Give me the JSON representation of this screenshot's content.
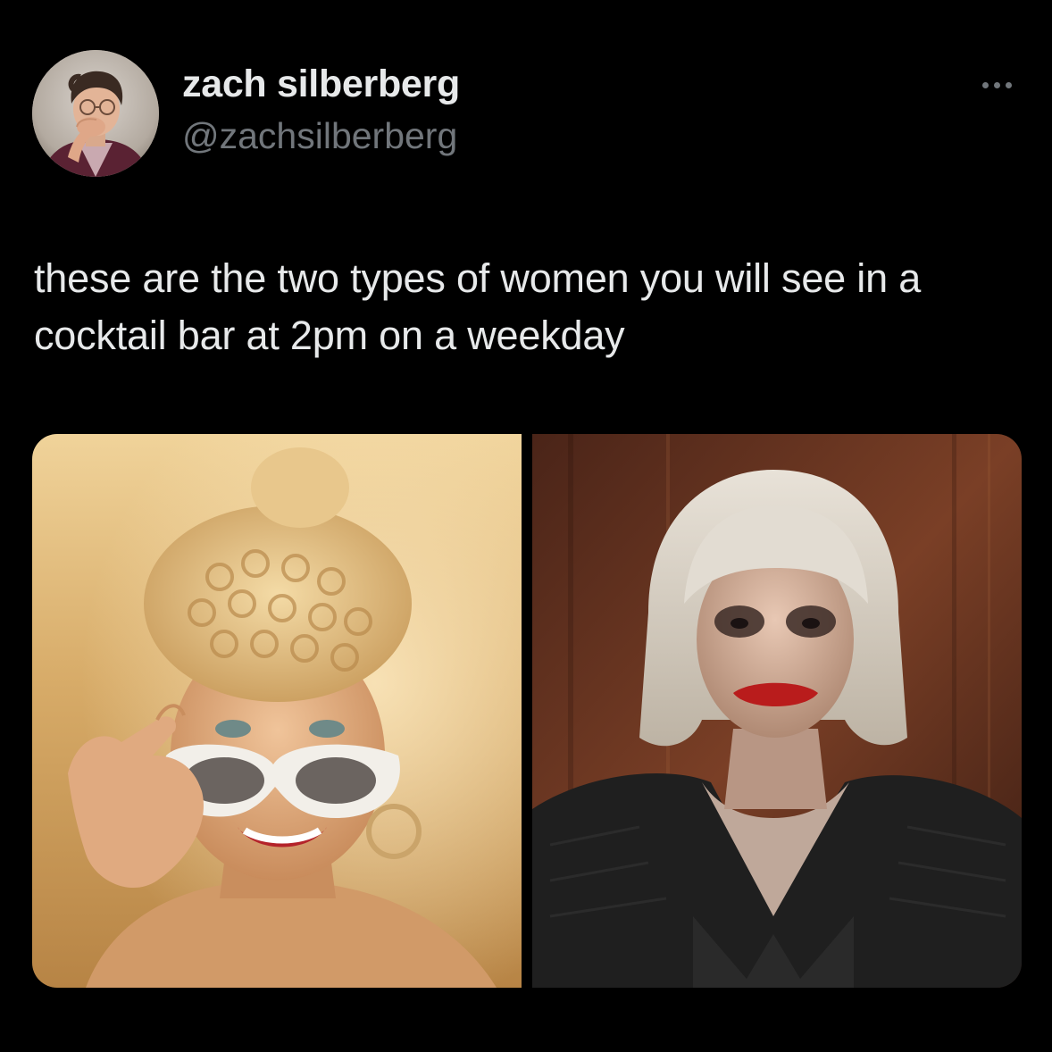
{
  "tweet": {
    "author": {
      "display_name": "zach silberberg",
      "handle": "@zachsilberberg",
      "avatar_icon": "user-avatar-photo"
    },
    "more_icon": "more-horizontal-icon",
    "text": "these are the two types of women you will see in a cocktail bar at 2pm on a weekday",
    "media": [
      {
        "icon": "photo-woman-white-sunglasses",
        "palette": [
          "#e9c98a",
          "#c99a52",
          "#a36f32"
        ]
      },
      {
        "icon": "photo-woman-clown-makeup",
        "palette": [
          "#5a2a1a",
          "#8b4a2b",
          "#1d1d1d"
        ]
      }
    ]
  },
  "colors": {
    "background": "#000000",
    "primary_text": "#e7e9ea",
    "secondary_text": "#71767b"
  }
}
